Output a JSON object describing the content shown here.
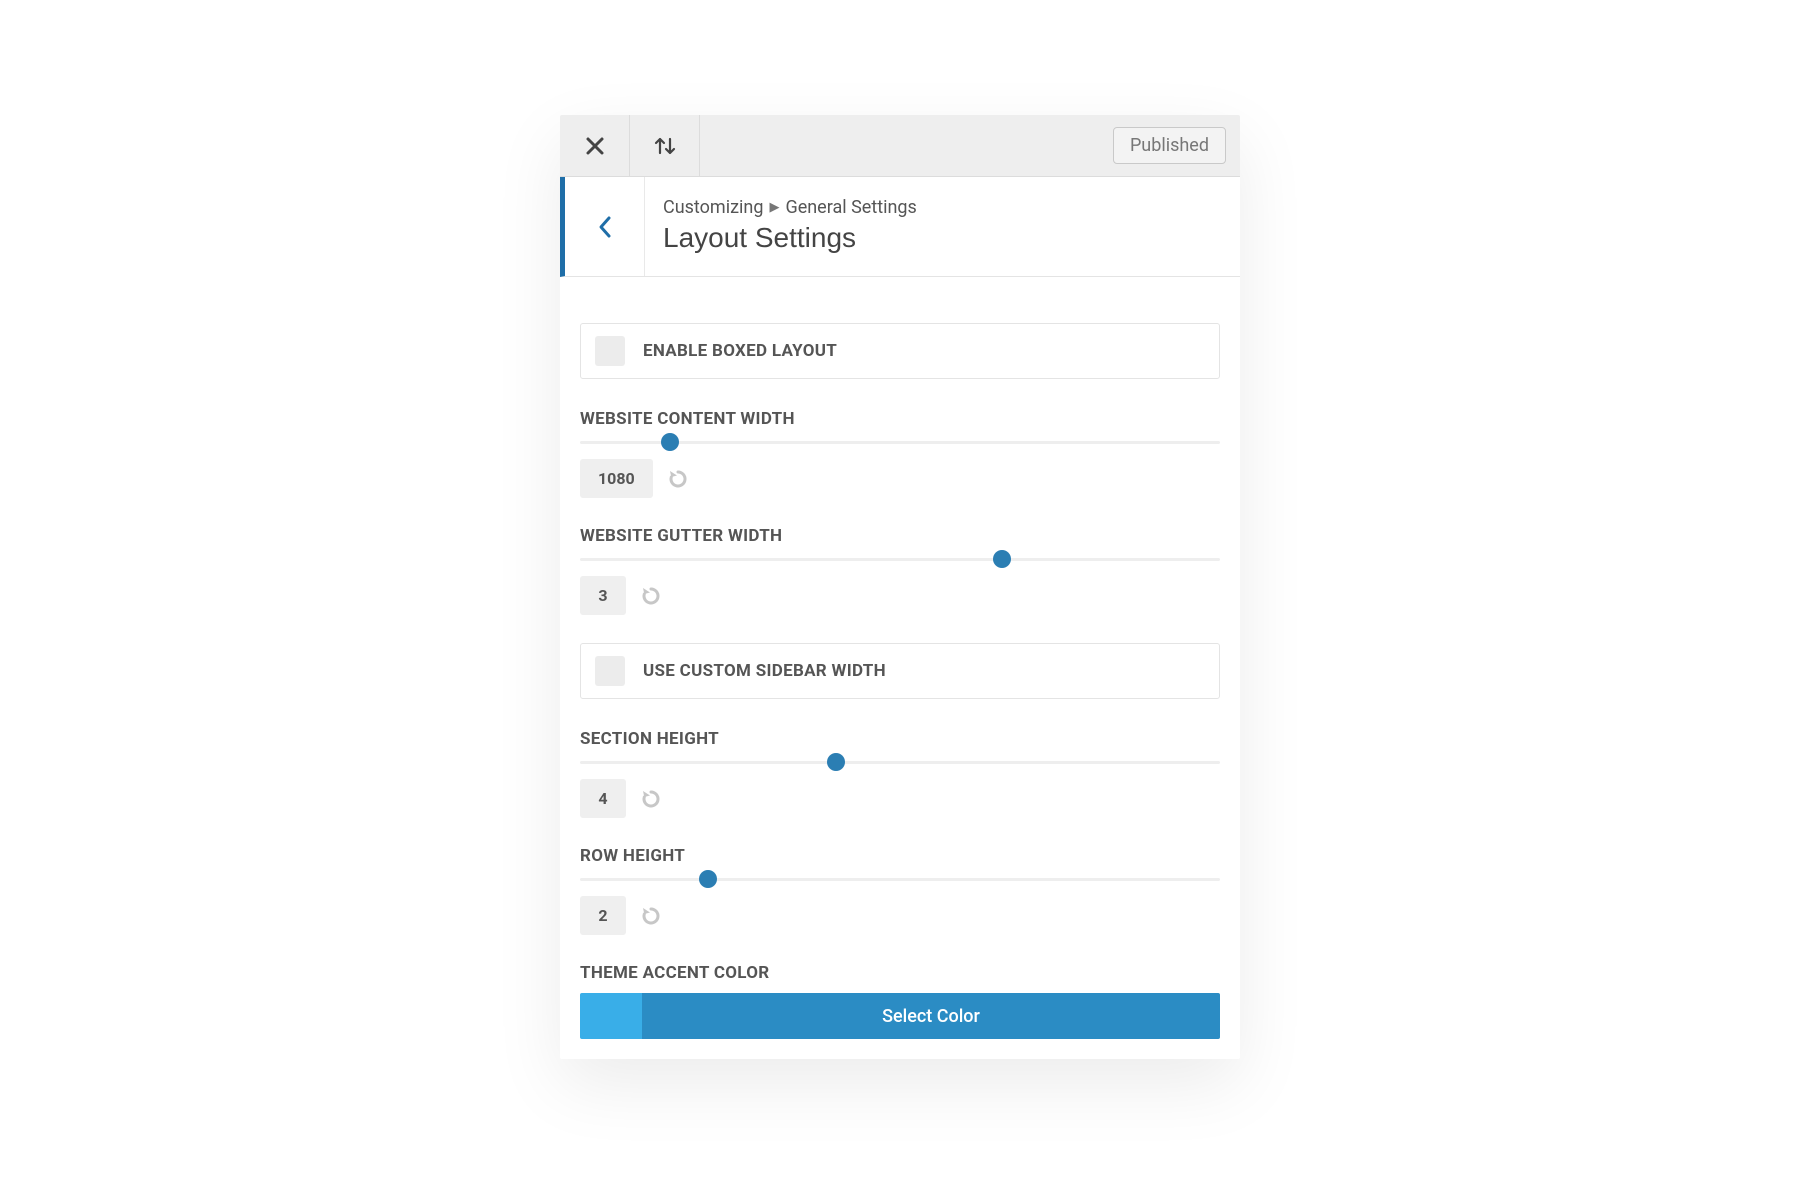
{
  "toolbar": {
    "status": "Published"
  },
  "header": {
    "breadcrumb_root": "Customizing",
    "breadcrumb_section": "General Settings",
    "title": "Layout Settings"
  },
  "settings": {
    "enable_boxed": {
      "label": "ENABLE BOXED LAYOUT"
    },
    "content_width": {
      "label": "WEBSITE CONTENT WIDTH",
      "value": "1080",
      "percent": 14
    },
    "gutter_width": {
      "label": "WEBSITE GUTTER WIDTH",
      "value": "3",
      "percent": 66
    },
    "custom_sidebar": {
      "label": "USE CUSTOM SIDEBAR WIDTH"
    },
    "section_height": {
      "label": "SECTION HEIGHT",
      "value": "4",
      "percent": 40
    },
    "row_height": {
      "label": "ROW HEIGHT",
      "value": "2",
      "percent": 20
    },
    "accent_color": {
      "label": "THEME ACCENT COLOR",
      "button": "Select Color",
      "swatch": "#39aee8",
      "main": "#2b8cc4"
    }
  }
}
